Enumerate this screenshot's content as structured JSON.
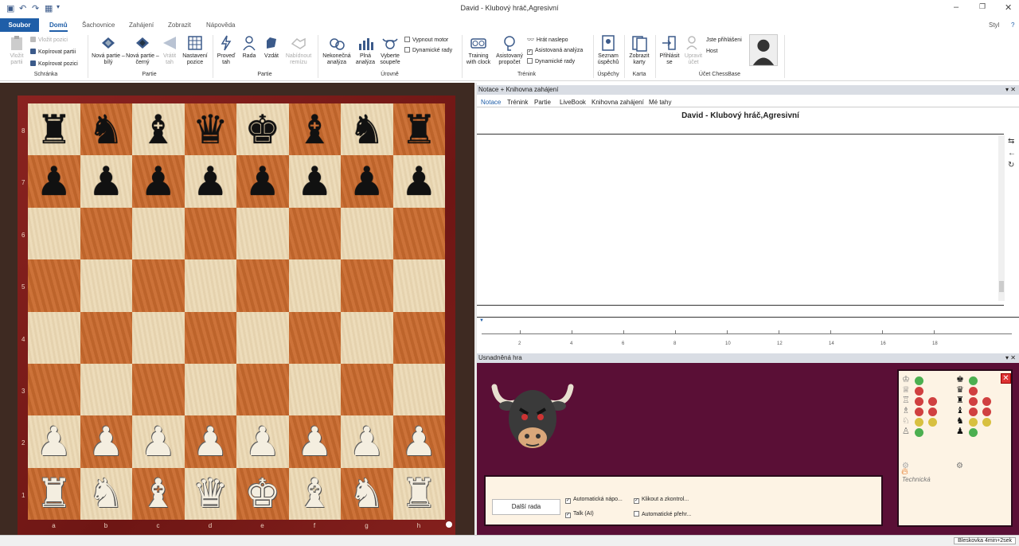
{
  "window": {
    "title": "David - Klubový hráč,Agresivní",
    "style_label": "Styl"
  },
  "ribbon_tabs": [
    {
      "label": "Soubor"
    },
    {
      "label": "Domů"
    },
    {
      "label": "Šachovnice"
    },
    {
      "label": "Zahájení"
    },
    {
      "label": "Zobrazit"
    },
    {
      "label": "Nápověda"
    }
  ],
  "ribbon": {
    "clipboard": {
      "paste_game": "Vložit partii",
      "paste_position": "Vložit pozici",
      "copy_game": "Kopírovat partii",
      "copy_position": "Kopírovat pozici",
      "group": "Schránka"
    },
    "game": {
      "new_white": "Nová partie – bílý",
      "new_black": "Nová partie – černý",
      "undo": "Vrátit tah",
      "setup": "Nastavení pozice",
      "group": "Partie"
    },
    "game2": {
      "move": "Proveď tah",
      "hint": "Rada",
      "resign": "Vzdát",
      "draw": "Nabídnout remízu",
      "group": "Partie"
    },
    "levels": {
      "infinite": "Nekonečná analýza",
      "full": "Plná analýza",
      "choose": "Vyberte soupeře",
      "engine_off": "Vypnout motor",
      "dyn_hints": "Dynamické rady",
      "group": "Úrovně"
    },
    "training": {
      "with_clock": "Training with clock",
      "assisted": "Asistovaný propočet",
      "blindfold": "Hrát naslepo",
      "assisted_analysis": "Asistovaná analýza",
      "dyn_hints": "Dynamické rady",
      "group": "Trénink"
    },
    "success": {
      "list": "Seznam úspěchů",
      "group": "Úspěchy"
    },
    "card": {
      "show": "Zobrazit karty",
      "group": "Karta"
    },
    "account": {
      "login": "Přihlásit se",
      "edit": "Upravit účet",
      "logged_in": "Jste přihlášeni",
      "host": "Host",
      "group": "Účet ChessBase"
    }
  },
  "board": {
    "ranks": [
      "8",
      "7",
      "6",
      "5",
      "4",
      "3",
      "2",
      "1"
    ],
    "files": [
      "a",
      "b",
      "c",
      "d",
      "e",
      "f",
      "g",
      "h"
    ],
    "position": [
      [
        "♜",
        "♞",
        "♝",
        "♛",
        "♚",
        "♝",
        "♞",
        "♜"
      ],
      [
        "♟",
        "♟",
        "♟",
        "♟",
        "♟",
        "♟",
        "♟",
        "♟"
      ],
      [
        "",
        "",
        "",
        "",
        "",
        "",
        "",
        ""
      ],
      [
        "",
        "",
        "",
        "",
        "",
        "",
        "",
        ""
      ],
      [
        "",
        "",
        "",
        "",
        "",
        "",
        "",
        ""
      ],
      [
        "",
        "",
        "",
        "",
        "",
        "",
        "",
        ""
      ],
      [
        "♟",
        "♟",
        "♟",
        "♟",
        "♟",
        "♟",
        "♟",
        "♟"
      ],
      [
        "♜",
        "♞",
        "♝",
        "♛",
        "♚",
        "♝",
        "♞",
        "♜"
      ]
    ]
  },
  "notation_pane": {
    "title": "Notace + Knihovna zahájení",
    "tabs": [
      {
        "label": "Notace"
      },
      {
        "label": "Trénink"
      },
      {
        "label": "Partie"
      },
      {
        "label": "LiveBook"
      },
      {
        "label": "Knihovna zahájení"
      },
      {
        "label": "Mé tahy"
      }
    ],
    "game_title": "David - Klubový hráč,Agresivní"
  },
  "timeline": {
    "ticks": [
      "2",
      "4",
      "6",
      "8",
      "10",
      "12",
      "14",
      "16",
      "18"
    ]
  },
  "helper_pane": {
    "title": "Usnadněná hra",
    "hint_button": "Další rada",
    "options": {
      "auto_hint": "Automatická nápo...",
      "click_check": "Klikout a zkontrol...",
      "talk": "Talk (AI)",
      "auto_play": "Automatické přehr..."
    },
    "technical_label": "Technická"
  },
  "status": {
    "time_control": "Bleskovka 4min+2sek"
  }
}
